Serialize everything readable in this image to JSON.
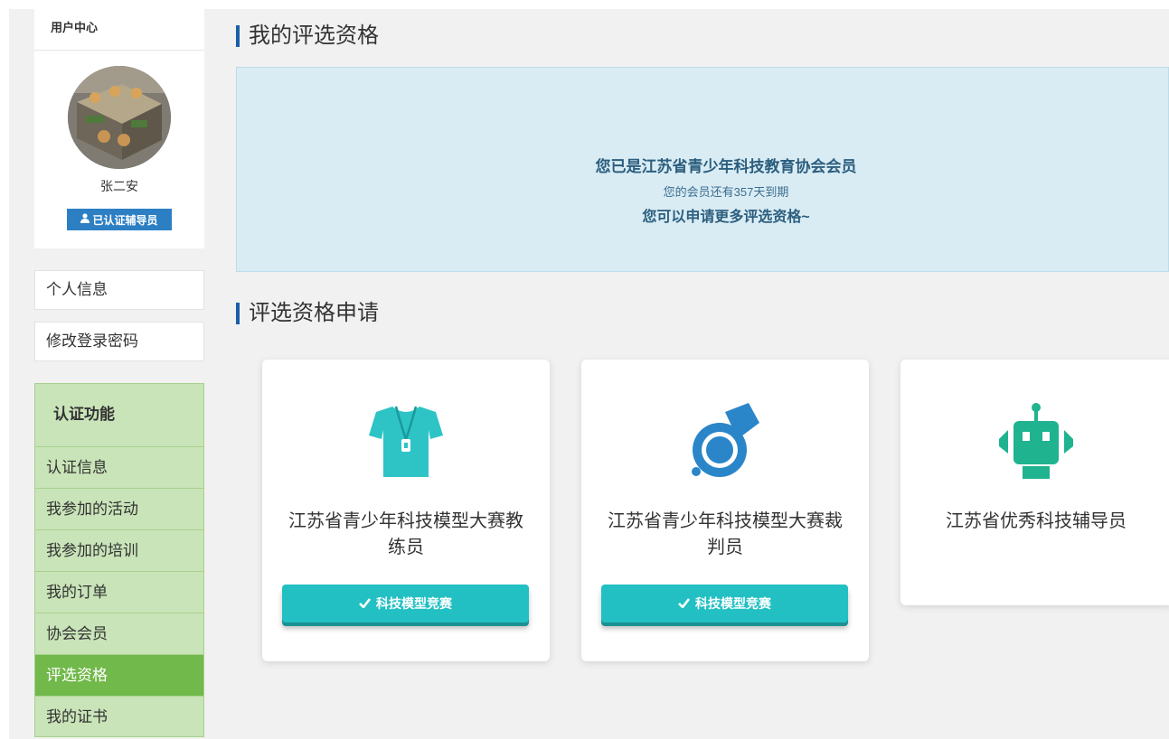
{
  "user_center": {
    "title": "用户中心",
    "user_name": "张二安",
    "badge_label": "已认证辅导员"
  },
  "sidebar": {
    "links": [
      {
        "label": "个人信息"
      },
      {
        "label": "修改登录密码"
      }
    ],
    "auth_section": {
      "title": "认证功能",
      "items": [
        {
          "label": "认证信息",
          "active": false
        },
        {
          "label": "我参加的活动",
          "active": false
        },
        {
          "label": "我参加的培训",
          "active": false
        },
        {
          "label": "我的订单",
          "active": false
        },
        {
          "label": "协会会员",
          "active": false
        },
        {
          "label": "评选资格",
          "active": true
        },
        {
          "label": "我的证书",
          "active": false
        }
      ]
    }
  },
  "main": {
    "my_qualification_title": "我的评选资格",
    "member_notice": {
      "line1": "您已是江苏省青少年科技教育协会会员",
      "line2": "您的会员还有357天到期",
      "line3": "您可以申请更多评选资格~"
    },
    "apply_title": "评选资格申请",
    "cards": [
      {
        "name": "江苏省青少年科技模型大赛教练员",
        "icon": "tshirt-whistle-icon",
        "icon_color": "#2ec4c6",
        "button_label": "科技模型竞赛"
      },
      {
        "name": "江苏省青少年科技模型大赛裁判员",
        "icon": "whistle-icon",
        "icon_color": "#2a86c9",
        "button_label": "科技模型竞赛"
      },
      {
        "name": "江苏省优秀科技辅导员",
        "icon": "robot-icon",
        "icon_color": "#20b38f"
      }
    ]
  },
  "colors": {
    "accent_bar": "#1b5fa8",
    "sidebar_active": "#71b94a",
    "button": "#22c0c2",
    "badge": "#2d7fc3"
  }
}
